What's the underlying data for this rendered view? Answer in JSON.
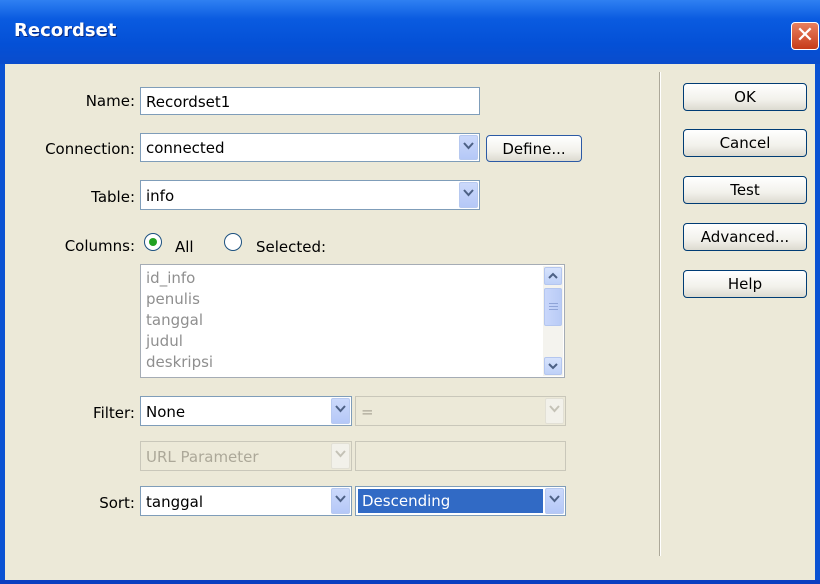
{
  "window": {
    "title": "Recordset",
    "close_symbol": "✕"
  },
  "form": {
    "name_label": "Name:",
    "name_value": "Recordset1",
    "connection_label": "Connection:",
    "connection_value": "connected",
    "define_button": "Define...",
    "table_label": "Table:",
    "table_value": "info",
    "columns_label": "Columns:",
    "columns_all_label": "All",
    "columns_selected_label": "Selected:",
    "columns_mode": "All",
    "columns_list": [
      "id_info",
      "penulis",
      "tanggal",
      "judul",
      "deskripsi"
    ],
    "filter_label": "Filter:",
    "filter_column": "None",
    "filter_operator": "=",
    "filter_source": "URL Parameter",
    "filter_value": "",
    "sort_label": "Sort:",
    "sort_column": "tanggal",
    "sort_order": "Descending"
  },
  "buttons": {
    "ok": "OK",
    "cancel": "Cancel",
    "test": "Test",
    "advanced": "Advanced...",
    "help": "Help"
  },
  "colors": {
    "titlebar": "#0450d6",
    "dialog_bg": "#ece9d8",
    "selection": "#316ac5",
    "close": "#c63b19"
  },
  "icons": {
    "close": "close-icon",
    "dropdown": "chevron-down-icon",
    "scroll_up": "chevron-up-icon",
    "scroll_down": "chevron-down-icon"
  }
}
